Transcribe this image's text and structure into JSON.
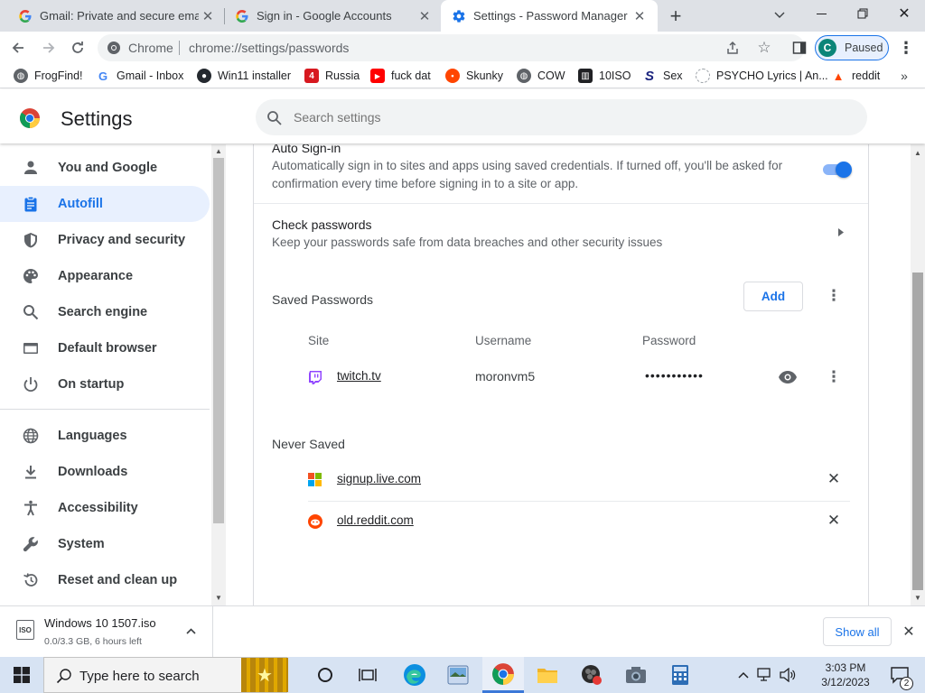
{
  "tabs": [
    {
      "title": "Gmail: Private and secure email at",
      "icon": "google-g-icon"
    },
    {
      "title": "Sign in - Google Accounts",
      "icon": "google-g-icon"
    },
    {
      "title": "Settings - Password Manager",
      "icon": "settings-gear-icon"
    }
  ],
  "toolbar": {
    "site_chip": "Chrome",
    "url": "chrome://settings/passwords",
    "profile_initial": "C",
    "profile_status": "Paused"
  },
  "bookmarks": [
    {
      "label": "FrogFind!",
      "icon": "globe-icon"
    },
    {
      "label": "Gmail - Inbox",
      "icon": "google-g-icon"
    },
    {
      "label": "Win11 installer",
      "icon": "github-icon"
    },
    {
      "label": "Russia",
      "icon": "red-square-icon"
    },
    {
      "label": "fuck dat",
      "icon": "youtube-icon"
    },
    {
      "label": "Skunky",
      "icon": "reddit-icon"
    },
    {
      "label": "COW",
      "icon": "globe-icon"
    },
    {
      "label": "10ISO",
      "icon": "building-icon"
    },
    {
      "label": "Sex",
      "icon": "s-logo-icon"
    },
    {
      "label": "PSYCHO Lyrics | An...",
      "icon": "spinner-icon"
    },
    {
      "label": "reddit",
      "icon": "reddit-hat-icon"
    }
  ],
  "settings": {
    "title": "Settings",
    "search_placeholder": "Search settings"
  },
  "sidebar": {
    "items": [
      {
        "label": "You and Google",
        "icon": "person-icon"
      },
      {
        "label": "Autofill",
        "icon": "clipboard-icon",
        "active": true
      },
      {
        "label": "Privacy and security",
        "icon": "shield-icon"
      },
      {
        "label": "Appearance",
        "icon": "palette-icon"
      },
      {
        "label": "Search engine",
        "icon": "search-icon"
      },
      {
        "label": "Default browser",
        "icon": "browser-window-icon"
      },
      {
        "label": "On startup",
        "icon": "power-icon"
      },
      {
        "label": "Languages",
        "icon": "globe-icon"
      },
      {
        "label": "Downloads",
        "icon": "download-icon"
      },
      {
        "label": "Accessibility",
        "icon": "accessibility-icon"
      },
      {
        "label": "System",
        "icon": "wrench-icon"
      },
      {
        "label": "Reset and clean up",
        "icon": "history-icon"
      }
    ]
  },
  "auto_signin": {
    "title": "Auto Sign-in",
    "description_line1": "Automatically sign in to sites and apps using saved credentials. If turned off, you'll be asked for",
    "description_line2": "confirmation every time before signing in to a site or app.",
    "enabled": true
  },
  "check_passwords": {
    "title": "Check passwords",
    "description": "Keep your passwords safe from data breaches and other security issues"
  },
  "saved_passwords": {
    "title": "Saved Passwords",
    "add_label": "Add",
    "columns": {
      "site": "Site",
      "username": "Username",
      "password": "Password"
    },
    "rows": [
      {
        "site": "twitch.tv",
        "username": "moronvm5",
        "password": "•••••••••••",
        "icon": "twitch-icon"
      }
    ]
  },
  "never_saved": {
    "title": "Never Saved",
    "rows": [
      {
        "site": "signup.live.com",
        "icon": "microsoft-logo-icon"
      },
      {
        "site": "old.reddit.com",
        "icon": "reddit-icon"
      }
    ]
  },
  "download": {
    "filename": "Windows 10 1507.iso",
    "status": "0.0/3.3 GB, 6 hours left",
    "show_all": "Show all"
  },
  "taskbar": {
    "search_placeholder": "Type here to search",
    "time": "3:03 PM",
    "date": "3/12/2023",
    "notification_count": "2"
  },
  "colors": {
    "accent": "#1a73e8",
    "active_nav_bg": "#e8f0fe",
    "tabstrip": "#dee1e6",
    "twitch": "#9146ff",
    "reddit": "#ff4500"
  }
}
